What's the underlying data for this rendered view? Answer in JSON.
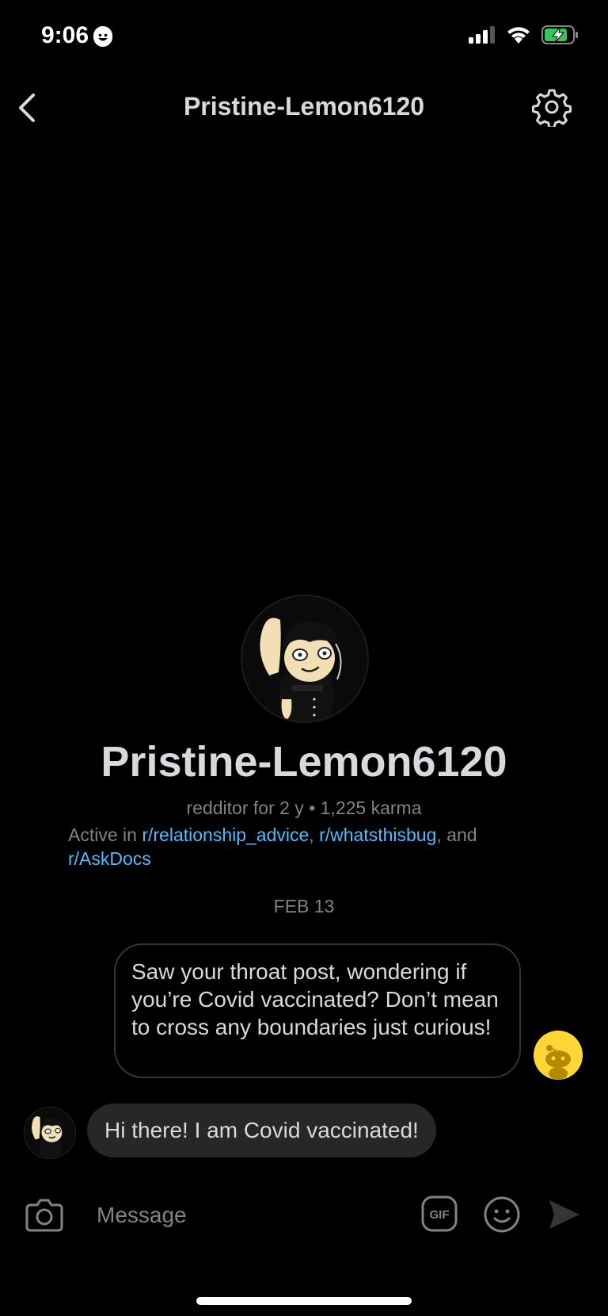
{
  "status_bar": {
    "time": "9:06"
  },
  "header": {
    "title": "Pristine-Lemon6120"
  },
  "profile": {
    "name": "Pristine-Lemon6120",
    "meta": "redditor for 2 y • 1,225 karma",
    "active_prefix": "Active in ",
    "communities": [
      "r/relationship_advice",
      "r/whatsthisbug",
      "r/AskDocs"
    ],
    "sep_comma": ", ",
    "sep_and": ", and"
  },
  "conversation": {
    "date": "FEB 13",
    "messages": [
      {
        "direction": "outgoing",
        "text": "Saw your throat post, wondering if you’re Covid vaccinated? Don’t mean to cross any boundaries just curious!"
      },
      {
        "direction": "incoming",
        "text": "Hi there! I am Covid vaccinated!"
      }
    ]
  },
  "composer": {
    "placeholder": "Message",
    "icons": [
      "camera-icon",
      "gif-icon",
      "emoji-icon",
      "send-icon"
    ]
  },
  "colors": {
    "background": "#000000",
    "text": "#d7dadc",
    "muted": "#818384",
    "link": "#4fbcff",
    "incoming_bubble": "#272729",
    "outgoing_border": "#343536",
    "battery_green": "#34c759",
    "snoo_yellow": "#ffd635"
  }
}
